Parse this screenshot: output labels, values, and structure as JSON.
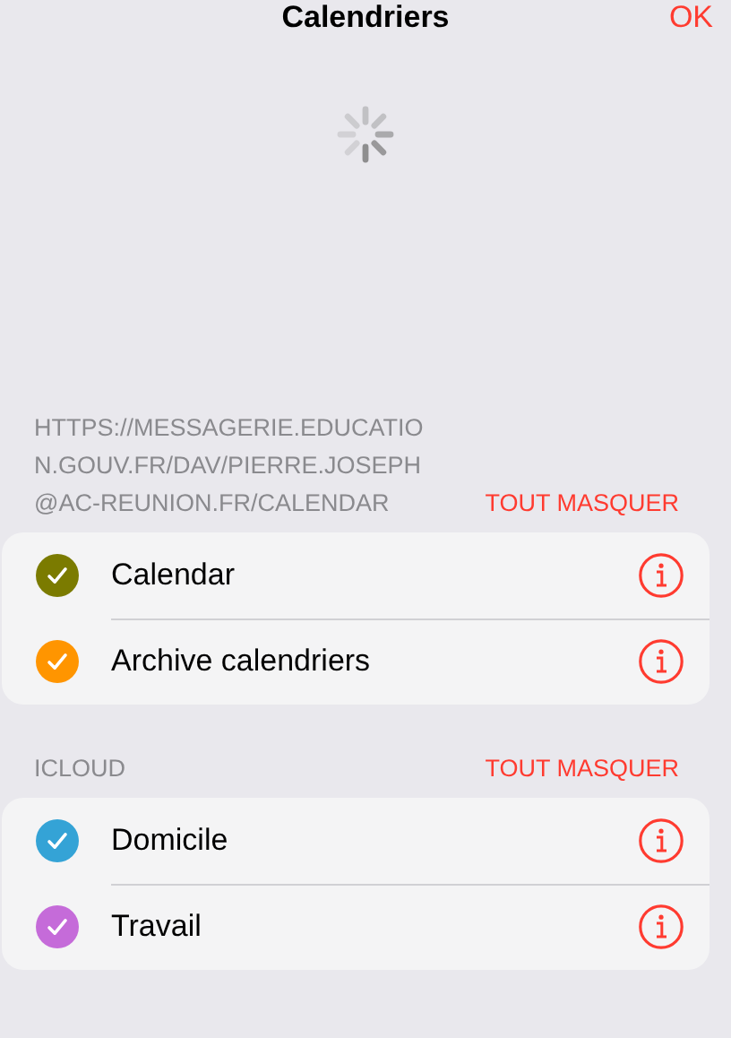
{
  "nav": {
    "title": "Calendriers",
    "done": "OK"
  },
  "loading": true,
  "sections": [
    {
      "header": "HTTPS://MESSAGERIE.EDUCATION.GOUV.FR/DAV/PIERRE.JOSEPH@AC-REUNION.FR/CALENDAR",
      "action": "TOUT MASQUER",
      "calendars": [
        {
          "name": "Calendar",
          "checked": true,
          "color": "#7b7b00"
        },
        {
          "name": "Archive calendriers",
          "checked": true,
          "color": "#ff9500"
        }
      ]
    },
    {
      "header": "ICLOUD",
      "action": "TOUT MASQUER",
      "calendars": [
        {
          "name": "Domicile",
          "checked": true,
          "color": "#34a3d6"
        },
        {
          "name": "Travail",
          "checked": true,
          "color": "#c56bd9"
        }
      ]
    }
  ]
}
